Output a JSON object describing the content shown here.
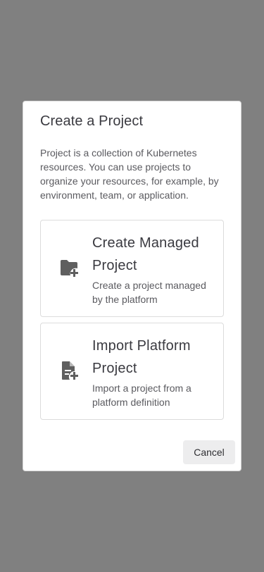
{
  "colors": {
    "overlay": "#808080",
    "dialog_background": "#ffffff",
    "icon": "#5f5f5f",
    "cancel_background": "#ededee"
  },
  "dialog": {
    "title": "Create a Project",
    "description": "Project is a collection of Kubernetes resources. You can use projects to organize your resources, for example, by environment, team, or application.",
    "options": [
      {
        "icon": "folder-plus-icon",
        "title": "Create Managed Project",
        "description": "Create a project managed by the platform"
      },
      {
        "icon": "document-plus-icon",
        "title": "Import Platform Project",
        "description": "Import a project from a platform definition"
      }
    ],
    "cancel_label": "Cancel"
  }
}
